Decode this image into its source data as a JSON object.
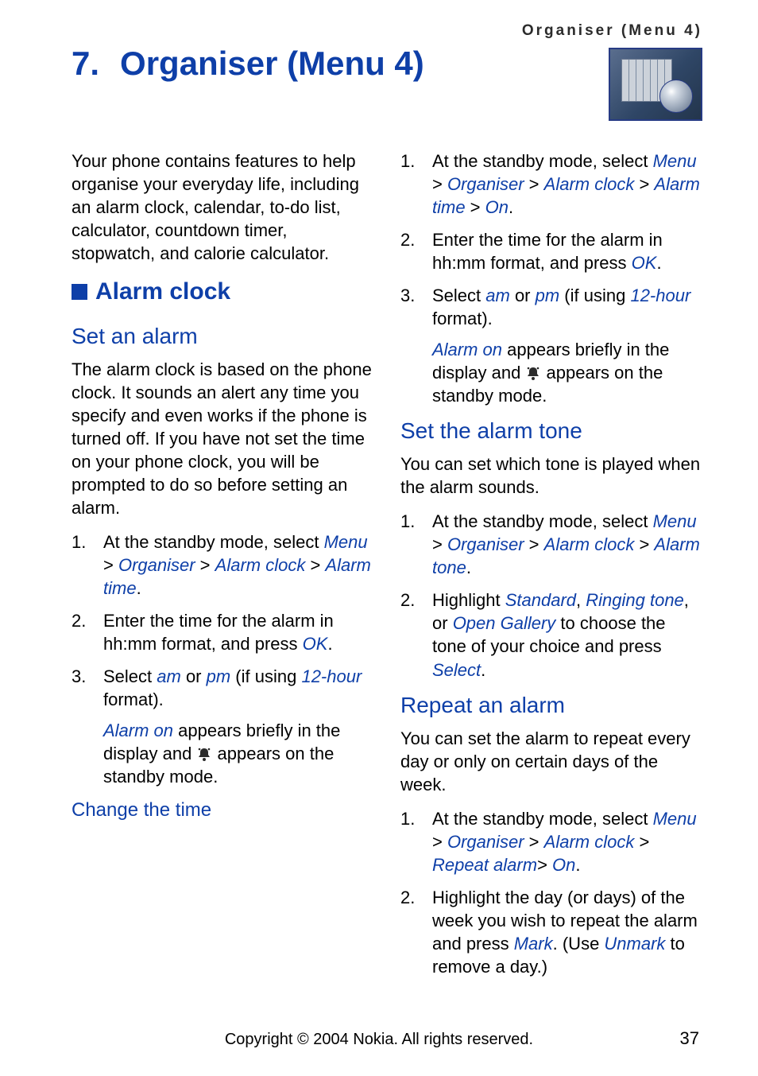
{
  "running_header": "Organiser (Menu 4)",
  "chapter": {
    "num": "7.",
    "title": "Organiser (Menu 4)"
  },
  "intro": "Your phone contains features to help organise your everyday life, including an alarm clock, calendar, to-do list, calculator, countdown timer, stopwatch, and calorie calculator.",
  "h2_alarm_clock": "Alarm clock",
  "set_alarm": {
    "heading": "Set an alarm",
    "body": "The alarm clock is based on the phone clock. It sounds an alert any time you specify and even works if the phone is turned off. If you have not set the time on your phone clock, you will be prompted to do so before setting an alarm.",
    "s1_a": "At the standby mode, select ",
    "s1_path": {
      "menu": "Menu",
      "gt1": " > ",
      "organiser": "Organiser",
      "gt2": " > ",
      "alarm_clock": "Alarm clock",
      "gt3": " > ",
      "alarm_time": "Alarm time",
      "dot": "."
    },
    "s2_a": "Enter the time for the alarm in hh:mm format, and press ",
    "s2_ok": "OK",
    "s2_dot": ".",
    "s3_a": "Select ",
    "s3_am": "am",
    "s3_or": " or ",
    "s3_pm": "pm",
    "s3_b": " (if using ",
    "s3_12h": "12-hour",
    "s3_c": " format).",
    "s3_sub_a": "Alarm on",
    "s3_sub_b": " appears briefly in the display and ",
    "s3_sub_c": " appears on the standby mode."
  },
  "change_time": {
    "heading": "Change the time",
    "s1_a": "At the standby mode, select ",
    "s1_path": {
      "menu": "Menu",
      "gt1": " > ",
      "organiser": "Organiser",
      "gt2": " > ",
      "alarm_clock": "Alarm clock",
      "gt3": " > ",
      "alarm_time": "Alarm time",
      "gt4": " > ",
      "on": "On",
      "dot": "."
    },
    "s2_a": "Enter the time for the alarm in hh:mm format, and press ",
    "s2_ok": "OK",
    "s2_dot": ".",
    "s3_a": "Select ",
    "s3_am": "am",
    "s3_or": " or ",
    "s3_pm": "pm",
    "s3_b": " (if using ",
    "s3_12h": "12-hour",
    "s3_c": " format).",
    "s3_sub_a": "Alarm on",
    "s3_sub_b": " appears briefly in the display and ",
    "s3_sub_c": " appears on the standby mode."
  },
  "set_tone": {
    "heading": "Set the alarm tone",
    "body": "You can set which tone is played when the alarm sounds.",
    "s1_a": "At the standby mode, select ",
    "s1_path": {
      "menu": "Menu",
      "gt1": " > ",
      "organiser": "Organiser",
      "gt2": " > ",
      "alarm_clock": "Alarm clock",
      "gt3": " > ",
      "alarm_tone": "Alarm tone",
      "dot": "."
    },
    "s2_a": "Highlight ",
    "s2_std": "Standard",
    "s2_c1": ", ",
    "s2_ring": "Ringing tone",
    "s2_c2": ", or ",
    "s2_open": "Open Gallery",
    "s2_b": " to choose the tone of your choice and press ",
    "s2_select": "Select",
    "s2_dot": "."
  },
  "repeat": {
    "heading": "Repeat an alarm",
    "body": "You can set the alarm to repeat every day or only on certain days of the week.",
    "s1_a": "At the standby mode, select ",
    "s1_path": {
      "menu": "Menu",
      "gt1": " > ",
      "organiser": "Organiser",
      "gt2": " > ",
      "alarm_clock": "Alarm clock",
      "gt3": " > ",
      "repeat_alarm": "Repeat alarm",
      "gt4": "> ",
      "on": "On",
      "dot": "."
    },
    "s2_a": "Highlight the day (or days) of the week you wish to repeat the alarm and press ",
    "s2_mark": "Mark",
    "s2_b": ". (Use ",
    "s2_unmark": "Unmark",
    "s2_c": " to remove a day.)"
  },
  "footer": "Copyright © 2004 Nokia. All rights reserved.",
  "pagenum": "37"
}
